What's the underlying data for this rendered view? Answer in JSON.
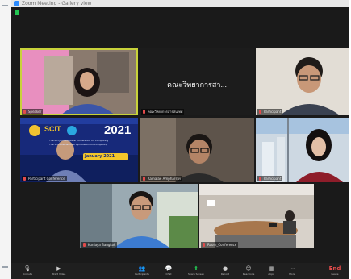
{
  "window": {
    "title": "Zoom Meeting - Gallery view"
  },
  "participants": [
    {
      "name": "Speaker"
    },
    {
      "name": "คณะวิทยาการสารสนเทศ",
      "display": "คณะวิทยาการสา..."
    },
    {
      "name": "Participant"
    },
    {
      "name": "Participant Conference"
    },
    {
      "name": "Kamalae Ampharswi"
    },
    {
      "name": "Participant"
    },
    {
      "name": "Kunlaya Bangkok"
    },
    {
      "name": "Room_Conference"
    }
  ],
  "banner": {
    "brand": "SCIT",
    "year": "2021",
    "line1": "The 6th Joint Regional Conference on Computing",
    "line2": "The 3rd International Symposium on Computing",
    "date": "January 2021"
  },
  "toolbar": [
    {
      "id": "mute",
      "label": "Unmute",
      "glyph": "🎙"
    },
    {
      "id": "video",
      "label": "Start Video",
      "glyph": "▶"
    },
    {
      "id": "participants",
      "label": "Participants",
      "glyph": "👥"
    },
    {
      "id": "chat",
      "label": "Chat",
      "glyph": "💬"
    },
    {
      "id": "share",
      "label": "Share Screen",
      "glyph": "⬆"
    },
    {
      "id": "record",
      "label": "Record",
      "glyph": "●"
    },
    {
      "id": "reactions",
      "label": "Reactions",
      "glyph": "☺"
    },
    {
      "id": "apps",
      "label": "Apps",
      "glyph": "▦"
    },
    {
      "id": "more",
      "label": "More",
      "glyph": "⋯"
    },
    {
      "id": "leave",
      "label": "Leave",
      "glyph": "End"
    }
  ],
  "colors": {
    "active_speaker": "#c8d23a",
    "share": "#23c552",
    "leave": "#e24b4b",
    "zoom_blue": "#2d8cff"
  }
}
